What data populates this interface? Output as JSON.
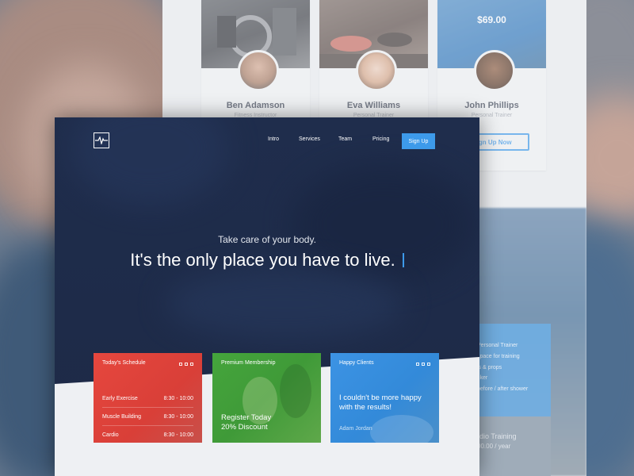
{
  "background_page": {
    "team": [
      {
        "name": "Ben Adamson",
        "role": "Fitness Instructor"
      },
      {
        "name": "Eva Williams",
        "role": "Personal Trainer"
      },
      {
        "name": "John Phillips",
        "role": "Personal Trainer",
        "price": "$69.00",
        "button": "Sign Up Now"
      }
    ],
    "pricing": {
      "features": [
        "Personal Trainer",
        "space for training",
        "ls & props",
        "cker",
        "before / after shower"
      ],
      "plan_title": "rdio Training",
      "plan_price": "00.00 / year"
    }
  },
  "nav": {
    "items": [
      "Intro",
      "Services",
      "Team",
      "Pricing"
    ],
    "signup": "Sign Up"
  },
  "hero": {
    "tagline": "Take care of your body.",
    "headline": "It's the only place you have to live."
  },
  "cards": {
    "schedule": {
      "title": "Today's Schedule",
      "rows": [
        {
          "name": "Early Exercise",
          "time": "8:30 - 10:00"
        },
        {
          "name": "Muscle Building",
          "time": "8:30 - 10:00"
        },
        {
          "name": "Cardio",
          "time": "8:30 - 10:00"
        }
      ]
    },
    "membership": {
      "title": "Premium Membership",
      "line1": "Register Today",
      "line2": "20% Discount"
    },
    "clients": {
      "title": "Happy Clients",
      "quote": "I couldn't be more happy with the results!",
      "author": "Adam Jordan"
    }
  },
  "colors": {
    "accent": "#3d9aea",
    "hero_bg": "#1e2c4a",
    "schedule_card": "#e0453c",
    "membership_card": "#46a63e",
    "clients_card": "#3b8fe0"
  }
}
